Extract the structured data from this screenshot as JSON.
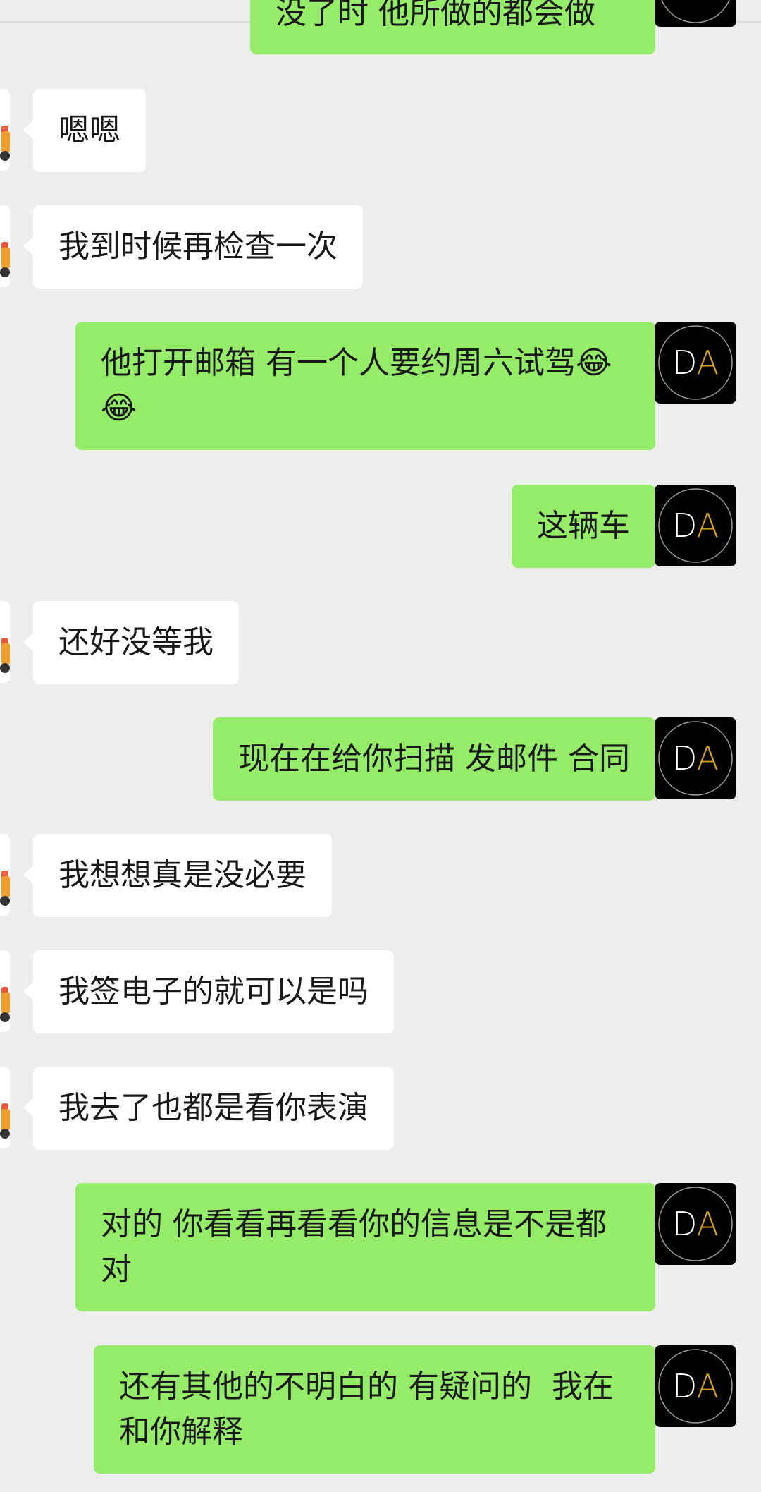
{
  "avatar_right": {
    "initials": "DA",
    "color_d": "#ffffff",
    "color_a": "#d4a017"
  },
  "messages": [
    {
      "side": "right",
      "text": "没了时 他所做的都会做"
    },
    {
      "side": "left",
      "text": "嗯嗯"
    },
    {
      "side": "left",
      "text": "我到时候再检查一次"
    },
    {
      "side": "right",
      "text": "他打开邮箱 有一个人要约周六试驾😂😂"
    },
    {
      "side": "right",
      "text": "这辆车"
    },
    {
      "side": "left",
      "text": "还好没等我"
    },
    {
      "side": "right",
      "text": "现在在给你扫描 发邮件 合同"
    },
    {
      "side": "left",
      "text": "我想想真是没必要"
    },
    {
      "side": "left",
      "text": "我签电子的就可以是吗"
    },
    {
      "side": "left",
      "text": "我去了也都是看你表演"
    },
    {
      "side": "right",
      "text": "对的 你看看再看看你的信息是不是都对"
    },
    {
      "side": "right",
      "text": "还有其他的不明白的 有疑问的  我在和你解释"
    }
  ]
}
